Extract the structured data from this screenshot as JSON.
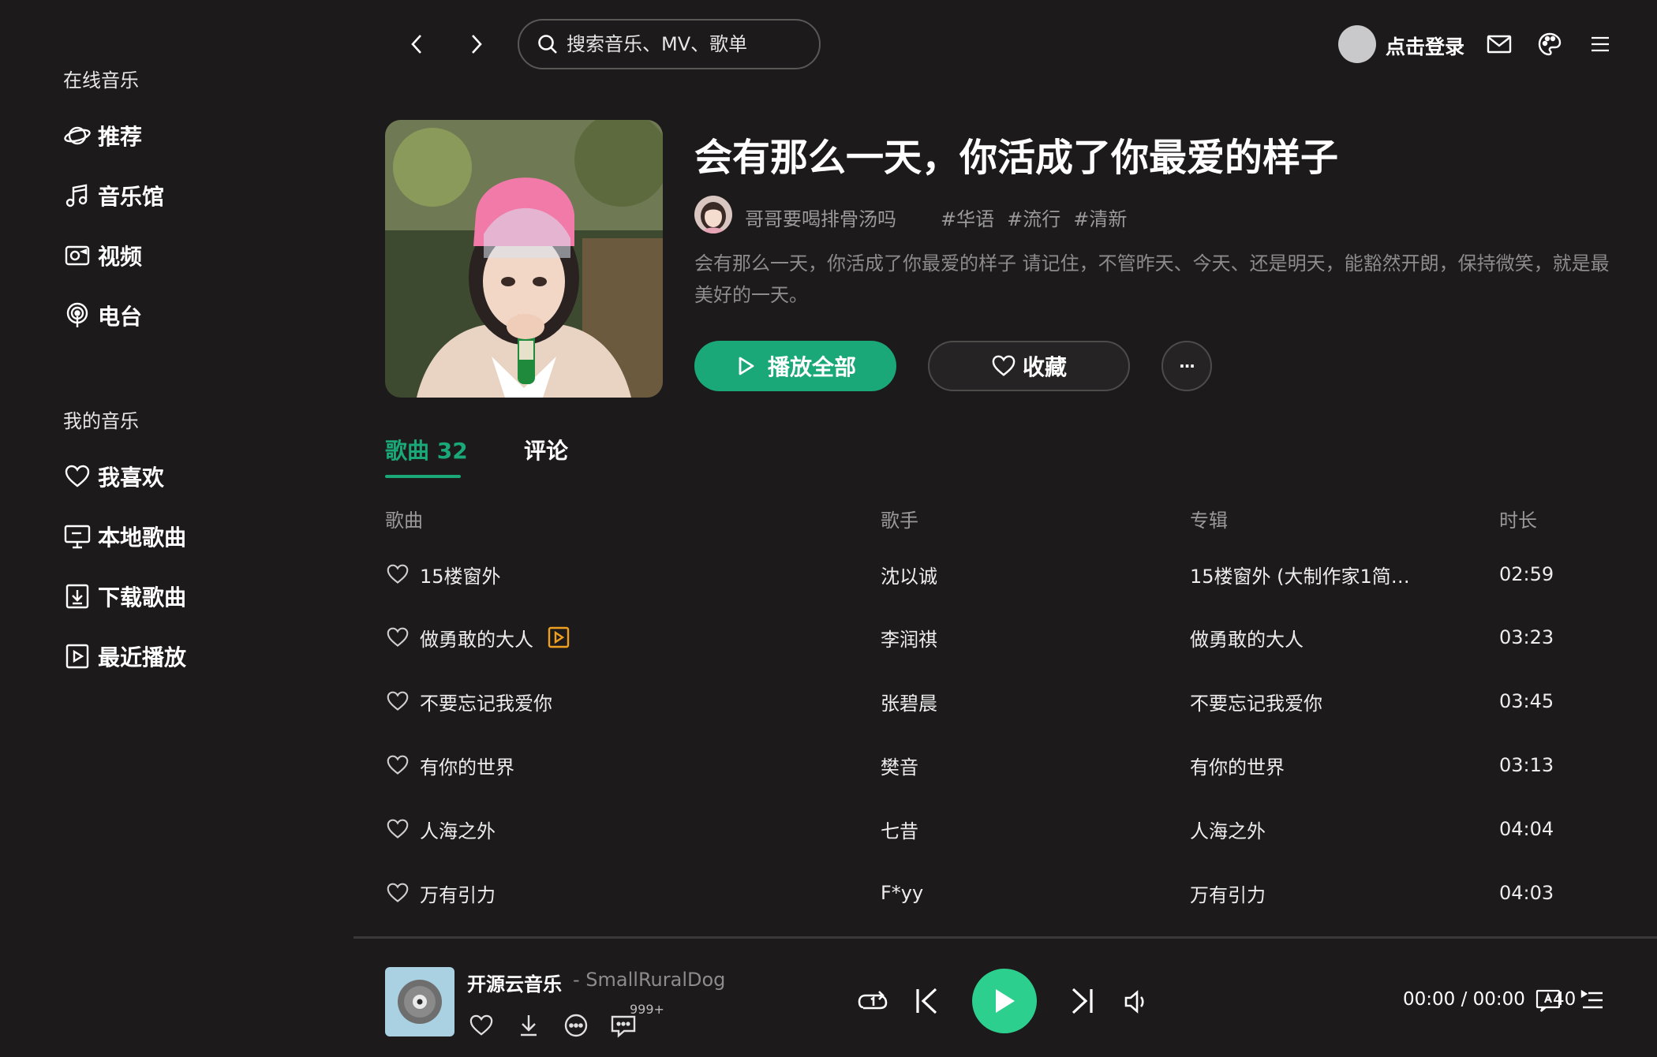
{
  "sidebar": {
    "online_title": "在线音乐",
    "online_items": [
      {
        "label": "推荐",
        "icon": "planet-icon"
      },
      {
        "label": "音乐馆",
        "icon": "music-note-icon"
      },
      {
        "label": "视频",
        "icon": "video-camera-icon"
      },
      {
        "label": "电台",
        "icon": "podcast-icon"
      }
    ],
    "mine_title": "我的音乐",
    "mine_items": [
      {
        "label": "我喜欢",
        "icon": "heart-icon"
      },
      {
        "label": "本地歌曲",
        "icon": "monitor-icon"
      },
      {
        "label": "下载歌曲",
        "icon": "download-icon"
      },
      {
        "label": "最近播放",
        "icon": "play-square-icon"
      }
    ]
  },
  "topbar": {
    "search_placeholder": "搜索音乐、MV、歌单",
    "login_label": "点击登录"
  },
  "playlist": {
    "title": "会有那么一天，你活成了你最爱的样子",
    "creator": "哥哥要喝排骨汤吗",
    "tags": [
      "#华语",
      "#流行",
      "#清新"
    ],
    "description": "会有那么一天，你活成了你最爱的样子 请记住，不管昨天、今天、还是明天，能豁然开朗，保持微笑，就是最美好的一天。",
    "play_all_label": "播放全部",
    "collect_label": "收藏",
    "more_label": "···"
  },
  "tabs": {
    "songs": "歌曲 32",
    "comments": "评论"
  },
  "table": {
    "headers": {
      "song": "歌曲",
      "singer": "歌手",
      "album": "专辑",
      "duration": "时长"
    },
    "rows": [
      {
        "title": "15楼窗外",
        "singer": "沈以诚",
        "album": "15楼窗外 (大制作家1简…",
        "duration": "02:59",
        "mv": false
      },
      {
        "title": "做勇敢的大人",
        "singer": "李润祺",
        "album": "做勇敢的大人",
        "duration": "03:23",
        "mv": true
      },
      {
        "title": "不要忘记我爱你",
        "singer": "张碧晨",
        "album": "不要忘记我爱你",
        "duration": "03:45",
        "mv": false
      },
      {
        "title": "有你的世界",
        "singer": "樊音",
        "album": "有你的世界",
        "duration": "03:13",
        "mv": false
      },
      {
        "title": "人海之外",
        "singer": "七昔",
        "album": "人海之外",
        "duration": "04:04",
        "mv": false
      },
      {
        "title": "万有引力",
        "singer": "F*yy",
        "album": "万有引力",
        "duration": "04:03",
        "mv": false
      }
    ]
  },
  "player": {
    "track_title": "开源云音乐",
    "track_artist": "- SmallRuralDog",
    "comment_count": "999+",
    "time": "00:00 / 00:00",
    "queue_count": "40"
  },
  "colors": {
    "accent": "#1aa879",
    "play_button": "#2dcf8e",
    "background": "#1c1a1a",
    "mv_badge": "#f0a020"
  }
}
